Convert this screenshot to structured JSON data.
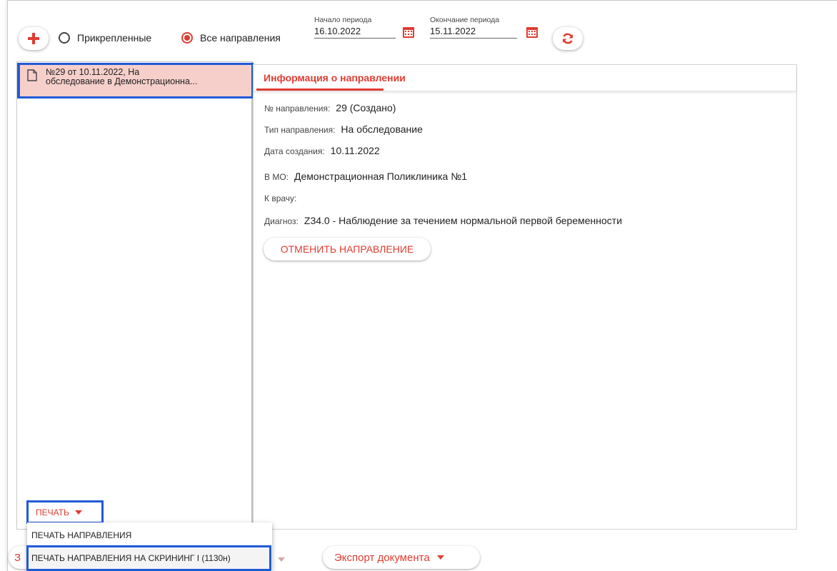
{
  "toolbar": {
    "add_icon": "plus-icon",
    "radio_attached_label": "Прикрепленные",
    "radio_all_label": "Все направления",
    "radio_selected": "all",
    "period_start_label": "Начало периода",
    "period_start_value": "16.10.2022",
    "period_end_label": "Окончание периода",
    "period_end_value": "15.11.2022",
    "calendar_icon": "calendar-icon",
    "refresh_icon": "refresh-icon"
  },
  "list": {
    "items": [
      {
        "icon": "document-icon",
        "line1": "№29 от 10.11.2022, На",
        "line2": "обследование в Демонстрационна...",
        "selected": true
      }
    ]
  },
  "details": {
    "tab_label": "Информация о направлении",
    "fields": [
      {
        "key": "№ направления:",
        "value": "29 (Создано)"
      },
      {
        "key": "Тип направления:",
        "value": "На обследование"
      },
      {
        "key": "Дата создания:",
        "value": "10.11.2022"
      },
      {
        "key": "В МО:",
        "value": "Демонстрационная Поликлиника №1"
      },
      {
        "key": "К врачу:",
        "value": ""
      },
      {
        "key": "Диагноз:",
        "value": "Z34.0 - Наблюдение за течением нормальной первой беременности"
      }
    ],
    "cancel_button": "ОТМЕНИТЬ НАПРАВЛЕНИЕ"
  },
  "print": {
    "button_label": "ПЕЧАТЬ",
    "menu": [
      "ПЕЧАТЬ НАПРАВЛЕНИЯ",
      "ПЕЧАТЬ НАПРАВЛЕНИЯ НА СКРИНИНГ I (1130н)"
    ]
  },
  "bottom_bar": {
    "partial_left": "З",
    "export_label": "Экспорт документа"
  },
  "colors": {
    "accent": "#e03c31",
    "selected_bg": "#f6cfcb",
    "highlight": "#1f5bd8"
  }
}
